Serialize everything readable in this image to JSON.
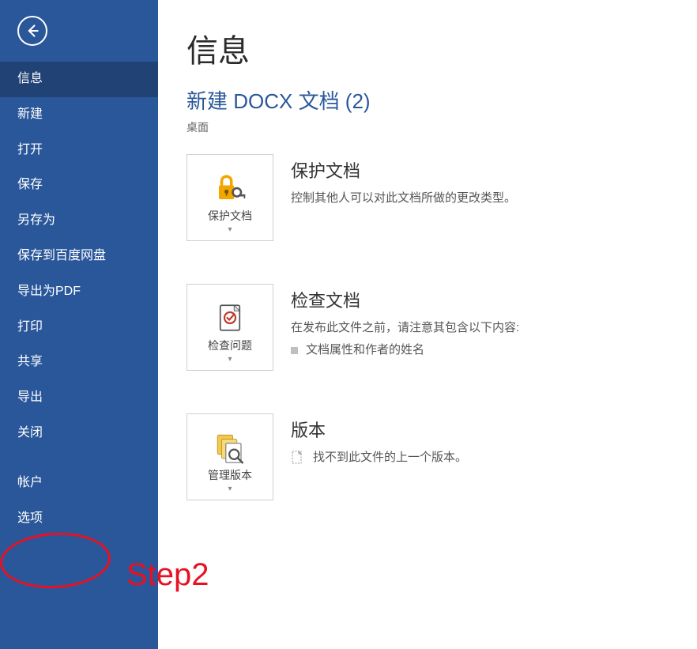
{
  "sidebar": {
    "items": [
      {
        "label": "信息",
        "selected": true
      },
      {
        "label": "新建"
      },
      {
        "label": "打开"
      },
      {
        "label": "保存"
      },
      {
        "label": "另存为"
      },
      {
        "label": "保存到百度网盘"
      },
      {
        "label": "导出为PDF"
      },
      {
        "label": "打印"
      },
      {
        "label": "共享"
      },
      {
        "label": "导出"
      },
      {
        "label": "关闭"
      }
    ],
    "footer_items": [
      {
        "label": "帐户"
      },
      {
        "label": "选项"
      }
    ]
  },
  "main": {
    "title": "信息",
    "doc_name": "新建 DOCX 文档 (2)",
    "doc_path": "桌面",
    "sections": {
      "protect": {
        "tile_label": "保护文档",
        "title": "保护文档",
        "desc": "控制其他人可以对此文档所做的更改类型。"
      },
      "inspect": {
        "tile_label": "检查问题",
        "title": "检查文档",
        "desc": "在发布此文件之前，请注意其包含以下内容:",
        "bullet": "文档属性和作者的姓名"
      },
      "versions": {
        "tile_label": "管理版本",
        "title": "版本",
        "desc": "找不到此文件的上一个版本。"
      }
    }
  },
  "annotation": {
    "label": "Step2"
  }
}
